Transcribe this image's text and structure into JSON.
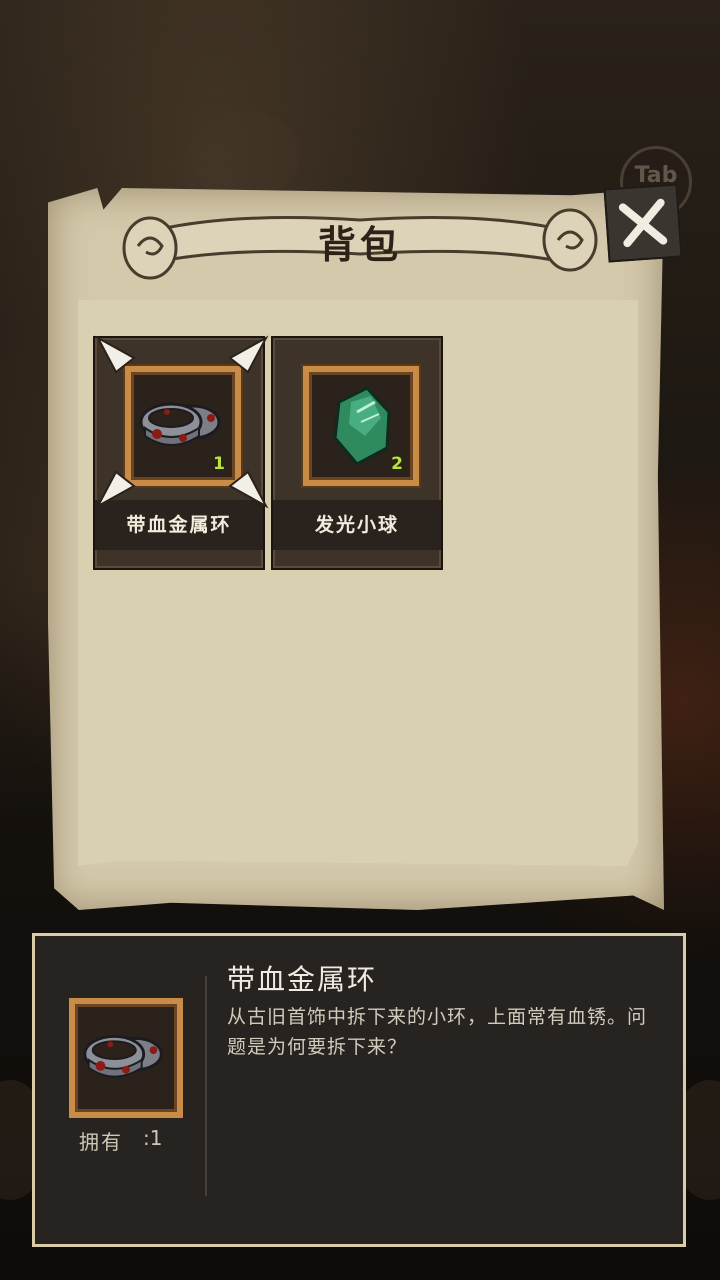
{
  "screen": {
    "title": "背包",
    "tab_hint": "Tab"
  },
  "inventory": {
    "items": [
      {
        "name": "带血金属环",
        "count": "1",
        "selected": true
      },
      {
        "name": "发光小球",
        "count": "2",
        "selected": false
      }
    ]
  },
  "detail": {
    "title": "带血金属环",
    "description": "从古旧首饰中拆下来的小环，上面常有血锈。问题是为何要拆下来？",
    "own_label": "拥有",
    "own_count": ":1"
  },
  "colors": {
    "parchment": "#d5c9ab",
    "frame_gold": "#c98c47",
    "count_green": "#b5e83a",
    "panel_dark": "#262320"
  }
}
